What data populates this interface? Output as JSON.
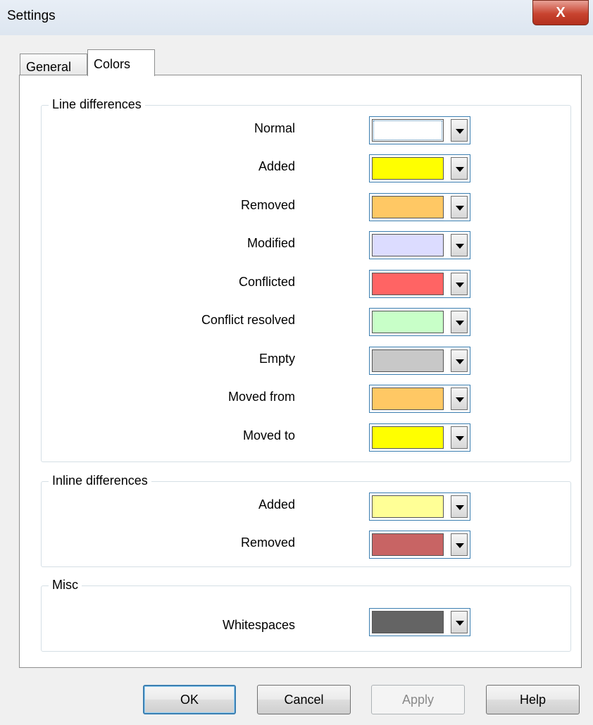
{
  "window": {
    "title": "Settings",
    "close_label": "X"
  },
  "tabs": [
    {
      "label": "General"
    },
    {
      "label": "Colors"
    }
  ],
  "groups": {
    "line_differences": {
      "label": "Line differences",
      "rows": [
        {
          "label": "Normal",
          "color": "#ffffff"
        },
        {
          "label": "Added",
          "color": "#ffff00"
        },
        {
          "label": "Removed",
          "color": "#ffc864"
        },
        {
          "label": "Modified",
          "color": "#dcdcff"
        },
        {
          "label": "Conflicted",
          "color": "#ff6464"
        },
        {
          "label": "Conflict resolved",
          "color": "#c8ffc8"
        },
        {
          "label": "Empty",
          "color": "#c8c8c8"
        },
        {
          "label": "Moved from",
          "color": "#ffc864"
        },
        {
          "label": "Moved to",
          "color": "#ffff00"
        }
      ]
    },
    "inline_differences": {
      "label": "Inline differences",
      "rows": [
        {
          "label": "Added",
          "color": "#ffff96"
        },
        {
          "label": "Removed",
          "color": "#c86464"
        }
      ]
    },
    "misc": {
      "label": "Misc",
      "rows": [
        {
          "label": "Whitespaces",
          "color": "#646464"
        }
      ]
    }
  },
  "buttons": {
    "ok": "OK",
    "cancel": "Cancel",
    "apply": "Apply",
    "help": "Help"
  }
}
